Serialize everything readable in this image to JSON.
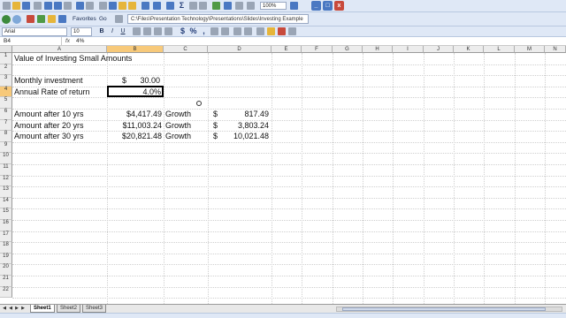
{
  "toolbar": {
    "zoom": "100%",
    "favorites_label": "Favorites",
    "go_label": "Go",
    "address": "C:\\Files\\Presentation Technology\\Presentations\\Slides\\Investing Example",
    "font_name": "Arial",
    "font_size": "10",
    "bold_label": "B",
    "italic_label": "I",
    "underline_label": "U"
  },
  "formula_bar": {
    "name_box": "B4",
    "fx_label": "fx",
    "content": "4%"
  },
  "grid": {
    "column_headers": [
      "A",
      "B",
      "C",
      "D",
      "E",
      "F",
      "G",
      "H",
      "I",
      "J",
      "K",
      "L",
      "M",
      "N"
    ],
    "row_headers": [
      "1",
      "2",
      "3",
      "4",
      "5",
      "6",
      "7",
      "8",
      "9",
      "10",
      "11",
      "12",
      "13",
      "14",
      "15",
      "16",
      "17",
      "18",
      "19",
      "20",
      "21",
      "22"
    ],
    "selected_cell": "B4"
  },
  "cells": {
    "a1": "Value of Investing Small Amounts",
    "a3": "Monthly investment",
    "b3_currency": "$",
    "b3_value": "30.00",
    "a4": "Annual Rate of return",
    "b4": "4.0%",
    "a6": "Amount after 10 yrs",
    "b6": "$4,417.49",
    "c6": "Growth",
    "d6_currency": "$",
    "d6_value": "817.49",
    "a7": "Amount after 20 yrs",
    "b7": "$11,003.24",
    "c7": "Growth",
    "d7_currency": "$",
    "d7_value": "3,803.24",
    "a8": "Amount after 30 yrs",
    "b8": "$20,821.48",
    "c8": "Growth",
    "d8_currency": "$",
    "d8_value": "10,021.48"
  },
  "sheet_tabs": [
    {
      "label": "Sheet1",
      "active": true
    },
    {
      "label": "Sheet2",
      "active": false
    },
    {
      "label": "Sheet3",
      "active": false
    }
  ],
  "colors": {
    "toolbar_bg": "#dfe8f6",
    "selected_header": "#f7c97a"
  }
}
